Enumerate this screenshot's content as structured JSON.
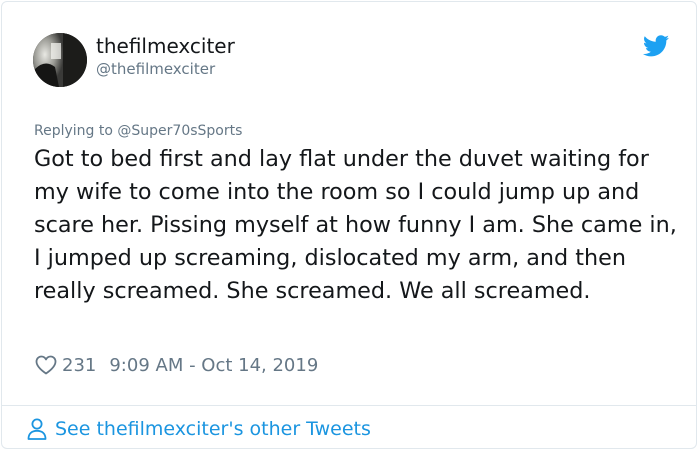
{
  "author": {
    "display_name": "thefilmexciter",
    "handle": "@thefilmexciter"
  },
  "reply": {
    "prefix": "Replying to ",
    "mention": "@Super70sSports"
  },
  "tweet": {
    "text": "Got to bed first and lay flat under the duvet waiting for my wife to come into the room so I could jump up and scare her. Pissing myself at how funny I am. She came in, I jumped up screaming, dislocated my arm, and then really screamed. She screamed. We all screamed."
  },
  "meta": {
    "like_count": "231",
    "timestamp": "9:09 AM - Oct 14, 2019"
  },
  "footer": {
    "link_label": "See thefilmexciter's other Tweets"
  },
  "icons": {
    "brand": "twitter-bird-icon",
    "like": "heart-icon",
    "profile": "person-icon"
  },
  "colors": {
    "brand_blue": "#1da1f2",
    "link_blue": "#1b95e0",
    "secondary_text": "#657786",
    "primary_text": "#14171a",
    "border": "#e1e8ed"
  }
}
